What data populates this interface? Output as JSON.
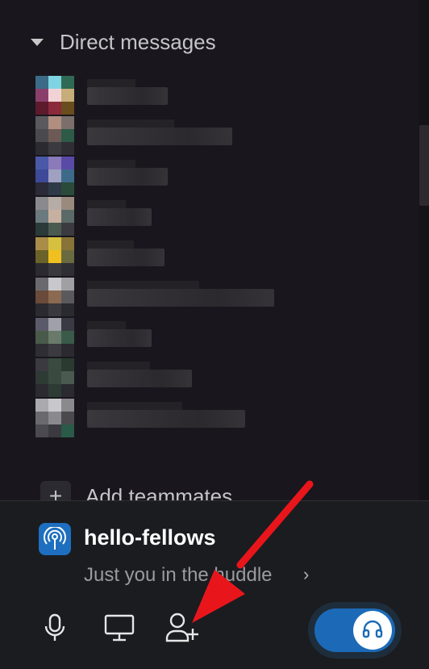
{
  "sidebar": {
    "section_title": "Direct messages",
    "dm_items": [
      {
        "avatar": [
          "#3b6b86",
          "#7fd4e4",
          "#2f6a55",
          "#8a3f6a",
          "#f1d3d7",
          "#c7ad78",
          "#5c1a2c",
          "#8b2a3b",
          "#6a4d1c"
        ],
        "name_width": 100
      },
      {
        "avatar": [
          "#5a5a5e",
          "#b08f80",
          "#7a6f6a",
          "#4a4a4e",
          "#6d5a56",
          "#2e5a48",
          "#2a2a30",
          "#3a3a40",
          "#2e2e34"
        ],
        "name_width": 180
      },
      {
        "avatar": [
          "#4a58a8",
          "#8a7ab8",
          "#5a4aa8",
          "#3e4a98",
          "#a0a0c0",
          "#3e6a8a",
          "#2a2a38",
          "#2e3a48",
          "#2a4a3a"
        ],
        "name_width": 100
      },
      {
        "avatar": [
          "#8a8a8e",
          "#b6aca6",
          "#9a8a7e",
          "#6a7a7e",
          "#c8b0a0",
          "#5a6a68",
          "#2a3a38",
          "#4a5a50",
          "#3a3a40"
        ],
        "name_width": 80
      },
      {
        "avatar": [
          "#a88c48",
          "#d6c040",
          "#887438",
          "#6a6228",
          "#f0c020",
          "#6a6a40",
          "#2a2a30",
          "#3a3a3e",
          "#2e2e34"
        ],
        "name_width": 96
      },
      {
        "avatar": [
          "#6a6a6e",
          "#c8c8cc",
          "#a0a0a4",
          "#6a4a3a",
          "#8a6a50",
          "#5a5a5e",
          "#2a2a30",
          "#3a3a3e",
          "#2a2a30"
        ],
        "name_width": 232
      },
      {
        "avatar": [
          "#5a5a6a",
          "#a0a0a8",
          "#3a3a44",
          "#4a5a4a",
          "#6a7a6a",
          "#3a5a4a",
          "#2e2e34",
          "#3a3a40",
          "#2a2a30"
        ],
        "name_width": 80
      },
      {
        "avatar": [
          "#3a3a40",
          "#3a4a40",
          "#2a3a30",
          "#2e3a34",
          "#3a4a40",
          "#4a5a50",
          "#2a2a30",
          "#2e3a34",
          "#2a2a30"
        ],
        "name_width": 130
      },
      {
        "avatar": [
          "#aaaaae",
          "#c8c8cc",
          "#8a8a8e",
          "#6a6a6e",
          "#8a8a8e",
          "#4a4a4e",
          "#4a4a50",
          "#3a3a40",
          "#2a5a48"
        ],
        "name_width": 196
      }
    ],
    "add_label": "Add teammates",
    "add_icon": "plus-icon"
  },
  "huddle": {
    "channel_name": "hello-fellows",
    "status_text": "Just you in the huddle",
    "channel_icon": "broadcast-icon",
    "controls": {
      "mic_icon": "microphone-icon",
      "screen_icon": "monitor-icon",
      "invite_icon": "add-person-icon",
      "headphones_icon": "headphones-icon"
    },
    "toggle_on": true
  },
  "colors": {
    "accent": "#1c6ab7",
    "annotation_arrow": "#e8161b",
    "background": "#19171d"
  }
}
